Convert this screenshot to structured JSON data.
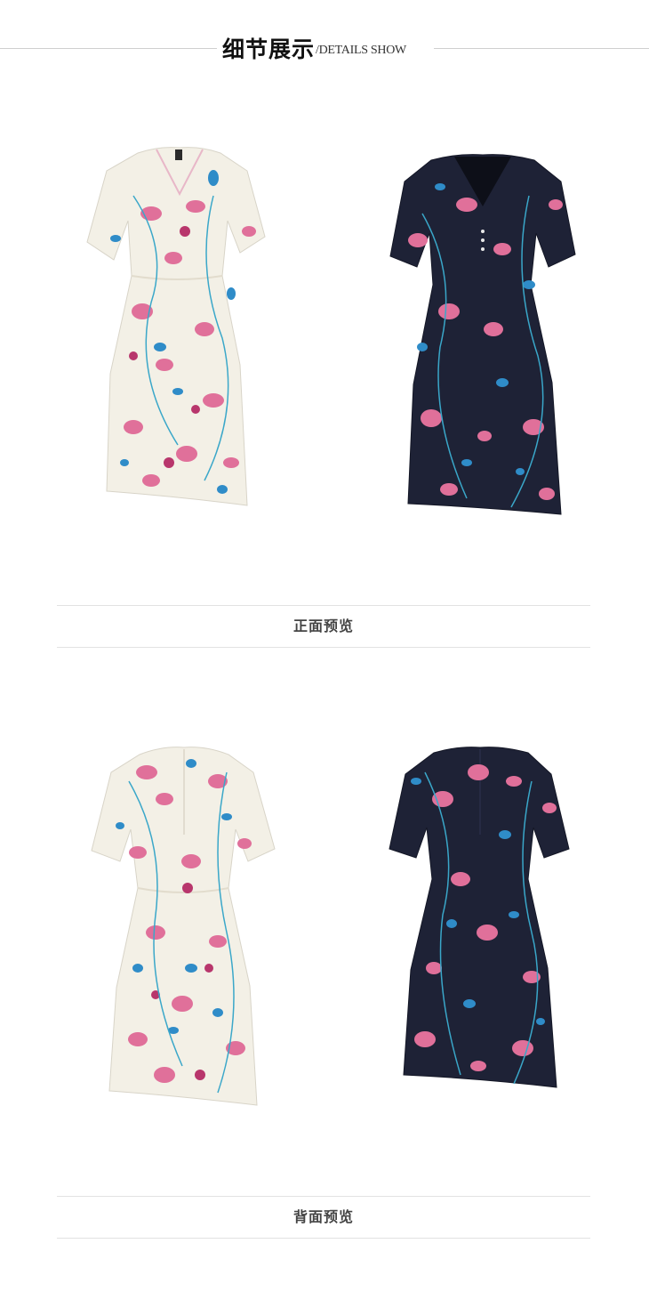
{
  "header": {
    "title_cn": "细节展示",
    "title_en": "/DETAILS SHOW"
  },
  "sections": [
    {
      "caption": "正面预览"
    },
    {
      "caption": "背面预览"
    }
  ],
  "palette": {
    "ivory_fabric": "#f3f0e6",
    "navy_fabric": "#1e2236",
    "flower_pink": "#e0709a",
    "flower_magenta": "#b8366c",
    "leaf_blue": "#2f8cc8",
    "leaf_teal": "#3aa7c9"
  }
}
